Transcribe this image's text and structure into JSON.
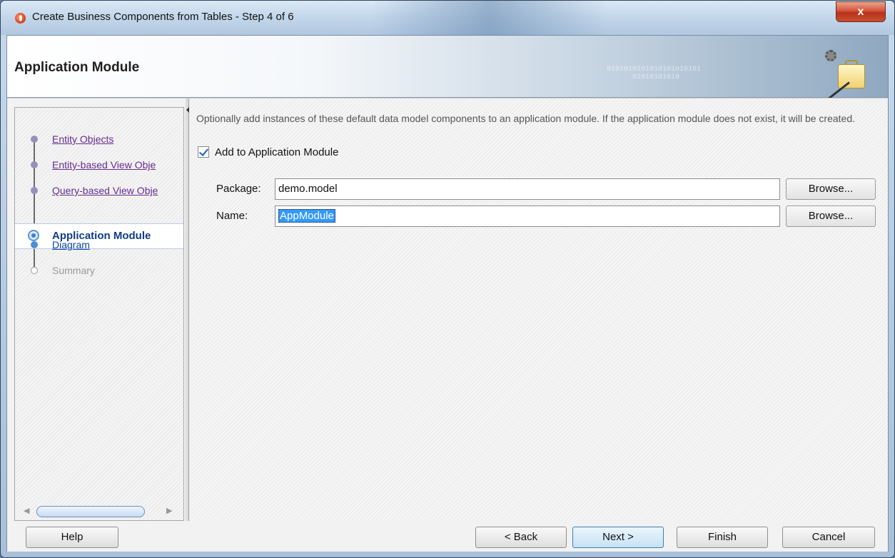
{
  "window": {
    "title": "Create Business Components from Tables - Step 4 of 6",
    "close_label": "x"
  },
  "banner": {
    "title": "Application Module",
    "decoration": "0101010101010101010101\n      01010101010"
  },
  "steps": [
    {
      "label": "Entity Objects",
      "state": "visited"
    },
    {
      "label": "Entity-based View Obje",
      "state": "visited"
    },
    {
      "label": "Query-based View Obje",
      "state": "visited"
    },
    {
      "label": "Application Module",
      "state": "current"
    },
    {
      "label": "Diagram",
      "state": "link"
    },
    {
      "label": "Summary",
      "state": "disabled"
    }
  ],
  "main": {
    "description": "Optionally add instances of these default data model components to an application module.  If the application module does not exist, it will be created.",
    "add_checkbox": {
      "label": "Add to Application Module",
      "checked": true
    },
    "package": {
      "label": "Package:",
      "value": "demo.model",
      "browse": "Browse..."
    },
    "name": {
      "label": "Name:",
      "value": "AppModule",
      "browse": "Browse..."
    }
  },
  "footer": {
    "help": "Help",
    "back": "< Back",
    "next": "Next >",
    "finish": "Finish",
    "cancel": "Cancel"
  }
}
